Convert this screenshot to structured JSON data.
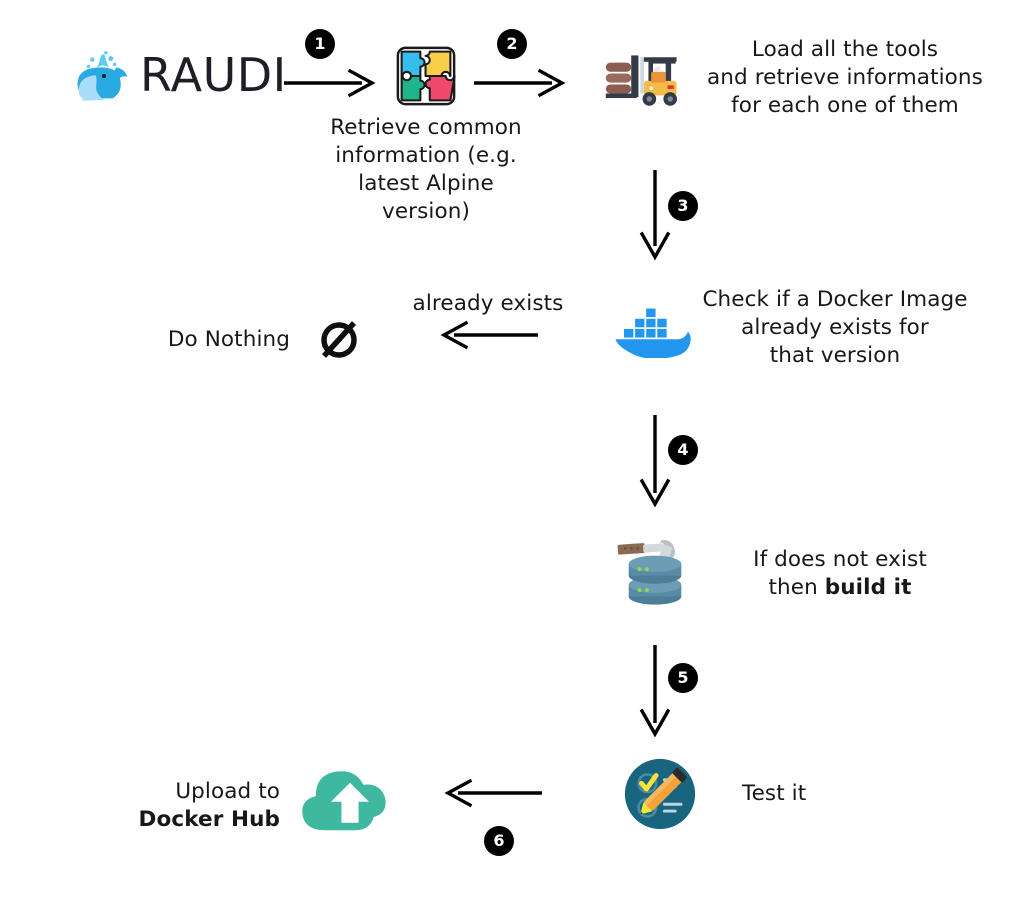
{
  "diagram": {
    "title": "RAUDI",
    "background_color": "#ffffff",
    "text_color": "#16181c",
    "badge_color": "#000000",
    "nodes": {
      "raudi": {
        "label": "RAUDI",
        "icon": "whale-icon"
      },
      "puzzle": {
        "icon": "puzzle-icon",
        "caption": "Retrieve common\ninformation (e.g.\nlatest Alpine\nversion)"
      },
      "forklift": {
        "icon": "forklift-icon",
        "caption": "Load all the tools\nand retrieve informations\nfor each one of them"
      },
      "docker_check": {
        "icon": "docker-whale-icon",
        "caption": "Check if a Docker Image\nalready exists for\nthat version"
      },
      "do_nothing": {
        "icon": "null-set-icon",
        "caption": "Do Nothing"
      },
      "build": {
        "icon": "hammer-database-icon",
        "caption_plain": "If does not exist\nthen ",
        "caption_bold": "build it"
      },
      "test": {
        "icon": "checklist-pencil-icon",
        "caption": "Test it"
      },
      "upload": {
        "icon": "cloud-upload-icon",
        "caption_plain": "Upload to\n",
        "caption_bold": "Docker Hub"
      }
    },
    "edges": [
      {
        "id": "edge-1",
        "number": "1",
        "direction": "right",
        "label": ""
      },
      {
        "id": "edge-2",
        "number": "2",
        "direction": "right",
        "label": ""
      },
      {
        "id": "edge-3",
        "number": "3",
        "direction": "down",
        "label": ""
      },
      {
        "id": "edge-exists",
        "number": "",
        "direction": "left",
        "label": "already exists"
      },
      {
        "id": "edge-4",
        "number": "4",
        "direction": "down",
        "label": ""
      },
      {
        "id": "edge-5",
        "number": "5",
        "direction": "down",
        "label": ""
      },
      {
        "id": "edge-6",
        "number": "6",
        "direction": "left",
        "label": ""
      }
    ],
    "colors": {
      "docker_blue": "#2396ed",
      "cloud_teal": "#3fb8a0",
      "test_circle": "#19657f",
      "pencil_orange": "#f5a23a",
      "check_yellow": "#f6e536",
      "puzzle_blue": "#35bdeb",
      "puzzle_yellow": "#f9cf4a",
      "puzzle_green": "#1fb58a",
      "puzzle_pink": "#ef4a6b",
      "forklift_yellow": "#f5bb4a",
      "forklift_dark": "#333b47",
      "cargo_brown": "#8a5c52",
      "db_blue": "#5a8aa6",
      "hammer_handle": "#8a6a52",
      "whale_blue": "#29abe2",
      "whale_light": "#a8ddf7",
      "arrow_black": "#000000"
    }
  }
}
